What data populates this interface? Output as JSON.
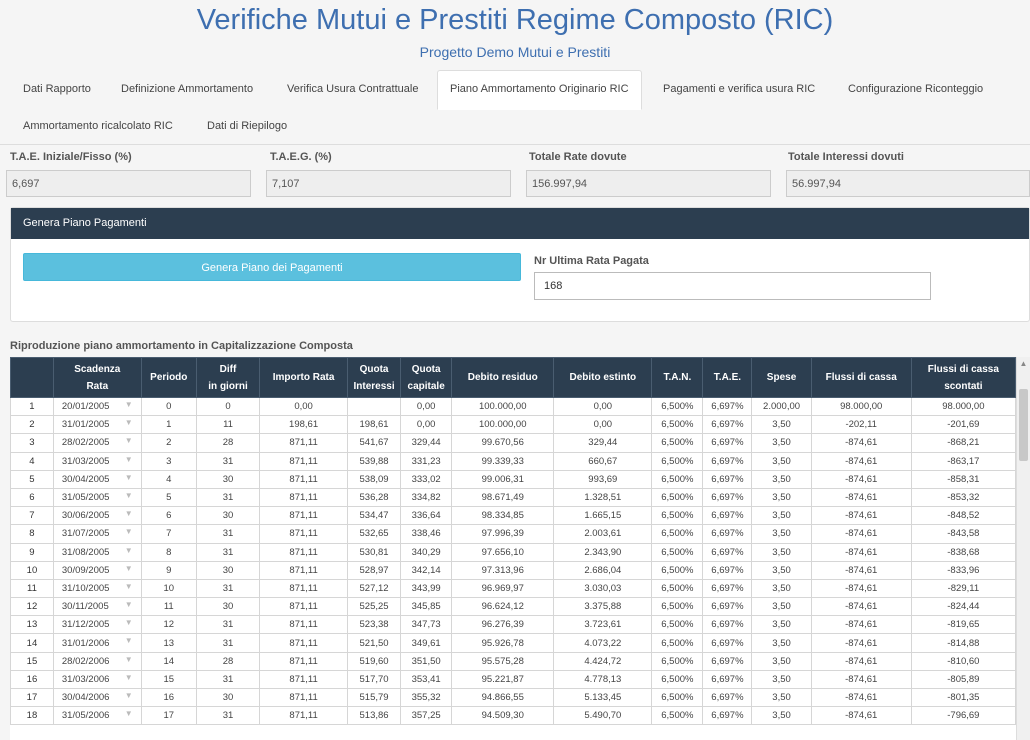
{
  "header": {
    "title": "Verifiche Mutui e Prestiti Regime Composto (RIC)",
    "subtitle": "Progetto Demo Mutui e Prestiti"
  },
  "tabs": [
    {
      "label": "Dati Rapporto"
    },
    {
      "label": "Definizione Ammortamento"
    },
    {
      "label": "Verifica Usura Contrattuale"
    },
    {
      "label": "Piano Ammortamento Originario RIC"
    },
    {
      "label": "Pagamenti e verifica usura RIC"
    },
    {
      "label": "Configurazione Riconteggio"
    },
    {
      "label": "Ammortamento ricalcolato RIC"
    },
    {
      "label": "Dati di Riepilogo"
    }
  ],
  "stats": [
    {
      "label": "T.A.E. Iniziale/Fisso (%)",
      "value": "6,697"
    },
    {
      "label": "T.A.E.G. (%)",
      "value": "7,107"
    },
    {
      "label": "Totale Rate dovute",
      "value": "156.997,94"
    },
    {
      "label": "Totale Interessi dovuti",
      "value": "56.997,94"
    }
  ],
  "panel": {
    "title": "Genera Piano Pagamenti",
    "button_label": "Genera Piano dei Pagamenti",
    "last_rata_label": "Nr Ultima Rata Pagata",
    "last_rata_value": "168"
  },
  "table": {
    "title": "Riproduzione piano ammortamento in Capitalizzazione Composta",
    "headers": [
      [
        "",
        ""
      ],
      [
        "Scadenza",
        "Rata"
      ],
      [
        "Periodo",
        ""
      ],
      [
        "Diff",
        "in giorni"
      ],
      [
        "Importo Rata",
        ""
      ],
      [
        "Quota",
        "Interessi"
      ],
      [
        "Quota",
        "capitale"
      ],
      [
        "Debito residuo",
        ""
      ],
      [
        "Debito estinto",
        ""
      ],
      [
        "T.A.N.",
        ""
      ],
      [
        "T.A.E.",
        ""
      ],
      [
        "Spese",
        ""
      ],
      [
        "Flussi di cassa",
        ""
      ],
      [
        "Flussi di cassa",
        "scontati"
      ]
    ],
    "rows": [
      [
        "1",
        "20/01/2005",
        "0",
        "0",
        "0,00",
        "",
        "0,00",
        "100.000,00",
        "0,00",
        "6,500%",
        "6,697%",
        "2.000,00",
        "98.000,00",
        "98.000,00"
      ],
      [
        "2",
        "31/01/2005",
        "1",
        "11",
        "198,61",
        "198,61",
        "0,00",
        "100.000,00",
        "0,00",
        "6,500%",
        "6,697%",
        "3,50",
        "-202,11",
        "-201,69"
      ],
      [
        "3",
        "28/02/2005",
        "2",
        "28",
        "871,11",
        "541,67",
        "329,44",
        "99.670,56",
        "329,44",
        "6,500%",
        "6,697%",
        "3,50",
        "-874,61",
        "-868,21"
      ],
      [
        "4",
        "31/03/2005",
        "3",
        "31",
        "871,11",
        "539,88",
        "331,23",
        "99.339,33",
        "660,67",
        "6,500%",
        "6,697%",
        "3,50",
        "-874,61",
        "-863,17"
      ],
      [
        "5",
        "30/04/2005",
        "4",
        "30",
        "871,11",
        "538,09",
        "333,02",
        "99.006,31",
        "993,69",
        "6,500%",
        "6,697%",
        "3,50",
        "-874,61",
        "-858,31"
      ],
      [
        "6",
        "31/05/2005",
        "5",
        "31",
        "871,11",
        "536,28",
        "334,82",
        "98.671,49",
        "1.328,51",
        "6,500%",
        "6,697%",
        "3,50",
        "-874,61",
        "-853,32"
      ],
      [
        "7",
        "30/06/2005",
        "6",
        "30",
        "871,11",
        "534,47",
        "336,64",
        "98.334,85",
        "1.665,15",
        "6,500%",
        "6,697%",
        "3,50",
        "-874,61",
        "-848,52"
      ],
      [
        "8",
        "31/07/2005",
        "7",
        "31",
        "871,11",
        "532,65",
        "338,46",
        "97.996,39",
        "2.003,61",
        "6,500%",
        "6,697%",
        "3,50",
        "-874,61",
        "-843,58"
      ],
      [
        "9",
        "31/08/2005",
        "8",
        "31",
        "871,11",
        "530,81",
        "340,29",
        "97.656,10",
        "2.343,90",
        "6,500%",
        "6,697%",
        "3,50",
        "-874,61",
        "-838,68"
      ],
      [
        "10",
        "30/09/2005",
        "9",
        "30",
        "871,11",
        "528,97",
        "342,14",
        "97.313,96",
        "2.686,04",
        "6,500%",
        "6,697%",
        "3,50",
        "-874,61",
        "-833,96"
      ],
      [
        "11",
        "31/10/2005",
        "10",
        "31",
        "871,11",
        "527,12",
        "343,99",
        "96.969,97",
        "3.030,03",
        "6,500%",
        "6,697%",
        "3,50",
        "-874,61",
        "-829,11"
      ],
      [
        "12",
        "30/11/2005",
        "11",
        "30",
        "871,11",
        "525,25",
        "345,85",
        "96.624,12",
        "3.375,88",
        "6,500%",
        "6,697%",
        "3,50",
        "-874,61",
        "-824,44"
      ],
      [
        "13",
        "31/12/2005",
        "12",
        "31",
        "871,11",
        "523,38",
        "347,73",
        "96.276,39",
        "3.723,61",
        "6,500%",
        "6,697%",
        "3,50",
        "-874,61",
        "-819,65"
      ],
      [
        "14",
        "31/01/2006",
        "13",
        "31",
        "871,11",
        "521,50",
        "349,61",
        "95.926,78",
        "4.073,22",
        "6,500%",
        "6,697%",
        "3,50",
        "-874,61",
        "-814,88"
      ],
      [
        "15",
        "28/02/2006",
        "14",
        "28",
        "871,11",
        "519,60",
        "351,50",
        "95.575,28",
        "4.424,72",
        "6,500%",
        "6,697%",
        "3,50",
        "-874,61",
        "-810,60"
      ],
      [
        "16",
        "31/03/2006",
        "15",
        "31",
        "871,11",
        "517,70",
        "353,41",
        "95.221,87",
        "4.778,13",
        "6,500%",
        "6,697%",
        "3,50",
        "-874,61",
        "-805,89"
      ],
      [
        "17",
        "30/04/2006",
        "16",
        "30",
        "871,11",
        "515,79",
        "355,32",
        "94.866,55",
        "5.133,45",
        "6,500%",
        "6,697%",
        "3,50",
        "-874,61",
        "-801,35"
      ],
      [
        "18",
        "31/05/2006",
        "17",
        "31",
        "871,11",
        "513,86",
        "357,25",
        "94.509,30",
        "5.490,70",
        "6,500%",
        "6,697%",
        "3,50",
        "-874,61",
        "-796,69"
      ]
    ]
  }
}
